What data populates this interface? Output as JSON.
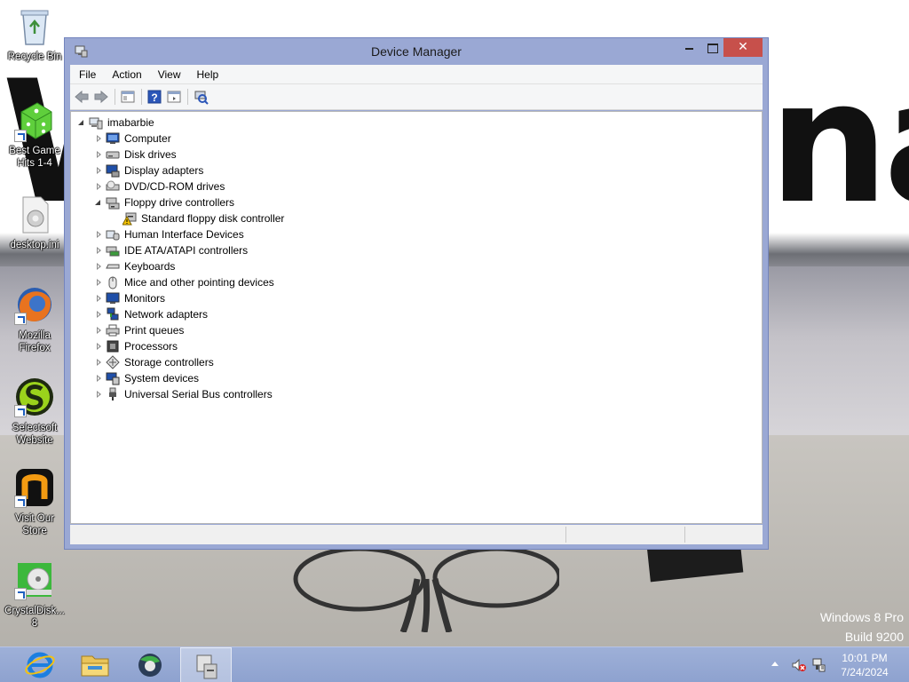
{
  "desktop": {
    "wallpaper_text_left": "W",
    "wallpaper_text_right": "na?",
    "watermark": {
      "line1": "Windows 8 Pro",
      "line2": "Build 9200"
    },
    "icons": [
      {
        "label": "Recycle Bin",
        "icon": "recycle-bin-icon"
      },
      {
        "label": "Best Game Hits 1-4",
        "icon": "dice-icon"
      },
      {
        "label": "desktop.ini",
        "icon": "settings-file-icon"
      },
      {
        "label": "Mozilla Firefox",
        "icon": "firefox-icon"
      },
      {
        "label": "Selectsoft Website",
        "icon": "selectsoft-icon"
      },
      {
        "label": "Visit Our Store",
        "icon": "store-icon"
      },
      {
        "label": "CrystalDisk... 8",
        "icon": "crystaldisk-icon"
      }
    ]
  },
  "window": {
    "title": "Device Manager",
    "close_glyph": "✕",
    "menu": [
      "File",
      "Action",
      "View",
      "Help"
    ],
    "toolbar": [
      "back",
      "forward",
      "show-hide-console-tree",
      "help",
      "properties",
      "scan-hardware-changes"
    ],
    "tree": {
      "root": "imabarbie",
      "items": [
        {
          "label": "Computer",
          "icon": "computer-icon",
          "expanded": false
        },
        {
          "label": "Disk drives",
          "icon": "disk-drive-icon",
          "expanded": false
        },
        {
          "label": "Display adapters",
          "icon": "display-adapter-icon",
          "expanded": false
        },
        {
          "label": "DVD/CD-ROM drives",
          "icon": "dvd-drive-icon",
          "expanded": false
        },
        {
          "label": "Floppy drive controllers",
          "icon": "floppy-controller-icon",
          "expanded": true,
          "children": [
            {
              "label": "Standard floppy disk controller",
              "icon": "warning-device-icon"
            }
          ]
        },
        {
          "label": "Human Interface Devices",
          "icon": "hid-icon",
          "expanded": false
        },
        {
          "label": "IDE ATA/ATAPI controllers",
          "icon": "ide-controller-icon",
          "expanded": false
        },
        {
          "label": "Keyboards",
          "icon": "keyboard-icon",
          "expanded": false
        },
        {
          "label": "Mice and other pointing devices",
          "icon": "mouse-icon",
          "expanded": false
        },
        {
          "label": "Monitors",
          "icon": "monitor-icon",
          "expanded": false
        },
        {
          "label": "Network adapters",
          "icon": "network-adapter-icon",
          "expanded": false
        },
        {
          "label": "Print queues",
          "icon": "printer-icon",
          "expanded": false
        },
        {
          "label": "Processors",
          "icon": "processor-icon",
          "expanded": false
        },
        {
          "label": "Storage controllers",
          "icon": "storage-controller-icon",
          "expanded": false
        },
        {
          "label": "System devices",
          "icon": "system-device-icon",
          "expanded": false
        },
        {
          "label": "Universal Serial Bus controllers",
          "icon": "usb-icon",
          "expanded": false
        }
      ]
    }
  },
  "taskbar": {
    "pinned": [
      "internet-explorer-icon",
      "file-explorer-icon",
      "browser-icon",
      "device-manager-icon"
    ],
    "active_index": 3,
    "tray": [
      "show-hidden-icons-chevron",
      "volume-muted-icon",
      "network-flag-icon"
    ],
    "time": "10:01 PM",
    "date": "7/24/2024"
  },
  "colors": {
    "window_frame": "#9aa8d4",
    "close_button": "#c7504b",
    "taskbar": "#94a7d3"
  }
}
